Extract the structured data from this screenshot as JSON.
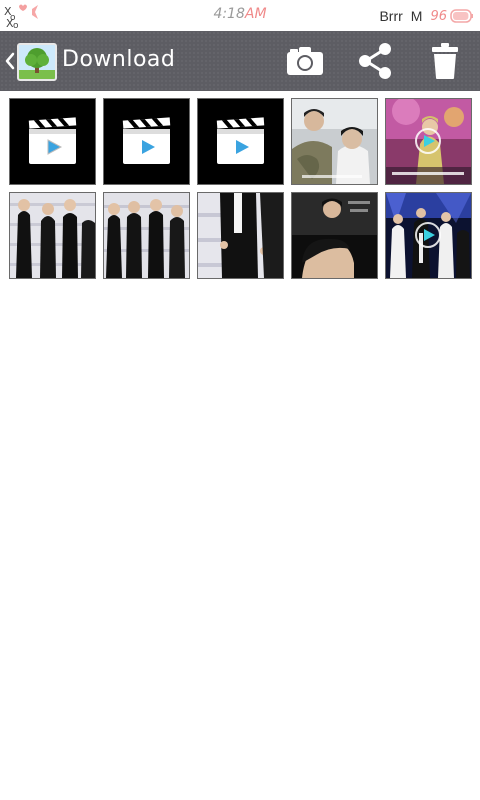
{
  "status_bar": {
    "logo_text": "XoXo",
    "time": "4:18",
    "ampm": "AM",
    "carrier": "Brrr",
    "mail_indicator": "M",
    "battery_level": "96",
    "battery_fraction": 0.96
  },
  "action_bar": {
    "back_icon": "chevron-left-icon",
    "app_icon": "gallery-tree-icon",
    "title": "Download",
    "actions": [
      {
        "name": "camera-button",
        "icon": "camera-icon"
      },
      {
        "name": "share-button",
        "icon": "share-icon"
      },
      {
        "name": "delete-button",
        "icon": "trash-icon"
      }
    ]
  },
  "gallery": {
    "items": [
      {
        "kind": "video-placeholder",
        "icon": "clapperboard-icon"
      },
      {
        "kind": "video-placeholder",
        "icon": "clapperboard-icon"
      },
      {
        "kind": "video-placeholder",
        "icon": "clapperboard-icon"
      },
      {
        "kind": "photo",
        "subject": "two people, one in camouflage jacket"
      },
      {
        "kind": "video",
        "subject": "performer on stage in pink light",
        "icon": "play-icon"
      },
      {
        "kind": "photo",
        "subject": "group in black suits at photo wall"
      },
      {
        "kind": "photo",
        "subject": "group in black suits at photo wall"
      },
      {
        "kind": "photo",
        "subject": "close-up of suits at photo wall"
      },
      {
        "kind": "photo",
        "subject": "dark photo with profile portrait"
      },
      {
        "kind": "video",
        "subject": "dancers on stage",
        "icon": "play-icon"
      }
    ]
  },
  "colors": {
    "action_bar_bg": "#5d5d63",
    "accent_pink": "#f08a8a",
    "page_bg": "#ffffff"
  }
}
